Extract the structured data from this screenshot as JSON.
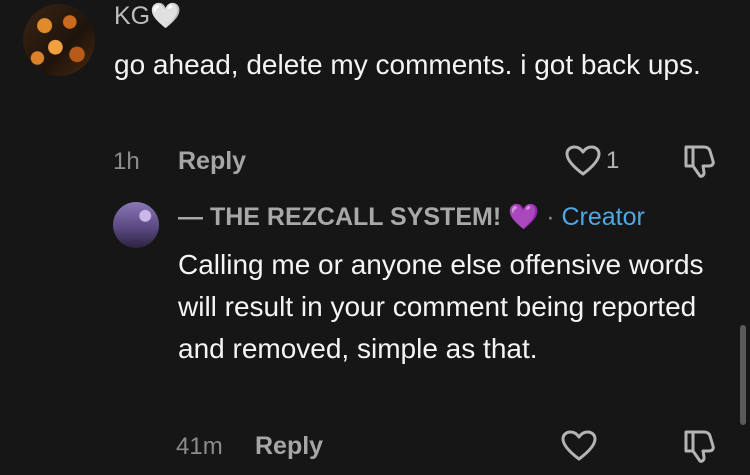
{
  "comment": {
    "username": "KG",
    "username_emoji": "🤍",
    "text": "go ahead, delete my comments. i got back ups.",
    "time": "1h",
    "reply_label": "Reply",
    "like_count": "1"
  },
  "reply": {
    "author": "— THE REZCALL SYSTEM!",
    "author_emoji": "💜",
    "separator": "·",
    "badge": "Creator",
    "text": "Calling me or anyone else offensive words will result in your comment being reported and removed, simple as that.",
    "time": "41m",
    "reply_label": "Reply"
  },
  "icons": {
    "like": "heart-icon",
    "dislike": "thumbs-down-icon"
  },
  "colors": {
    "background": "#161616",
    "creator_badge": "#4ea8e6"
  }
}
